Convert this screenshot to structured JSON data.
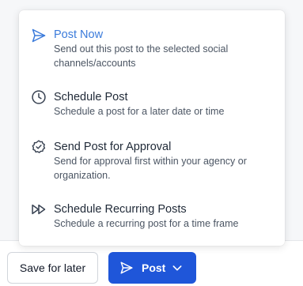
{
  "menu": {
    "items": [
      {
        "icon": "send-icon",
        "title": "Post Now",
        "description": "Send out this post to the selected social channels/accounts",
        "active": true
      },
      {
        "icon": "clock-icon",
        "title": "Schedule Post",
        "description": "Schedule a post for a later date or time"
      },
      {
        "icon": "badge-check-icon",
        "title": "Send Post for Approval",
        "description": "Send for approval first within your agency or organization."
      },
      {
        "icon": "fast-forward-icon",
        "title": "Schedule Recurring Posts",
        "description": "Schedule a recurring post for a time frame"
      }
    ]
  },
  "footer": {
    "save_label": "Save for later",
    "post_label": "Post"
  },
  "colors": {
    "accent": "#3b7bdb",
    "primary_button": "#1f56d9",
    "text": "#1f2937",
    "muted_text": "#4b5563"
  }
}
